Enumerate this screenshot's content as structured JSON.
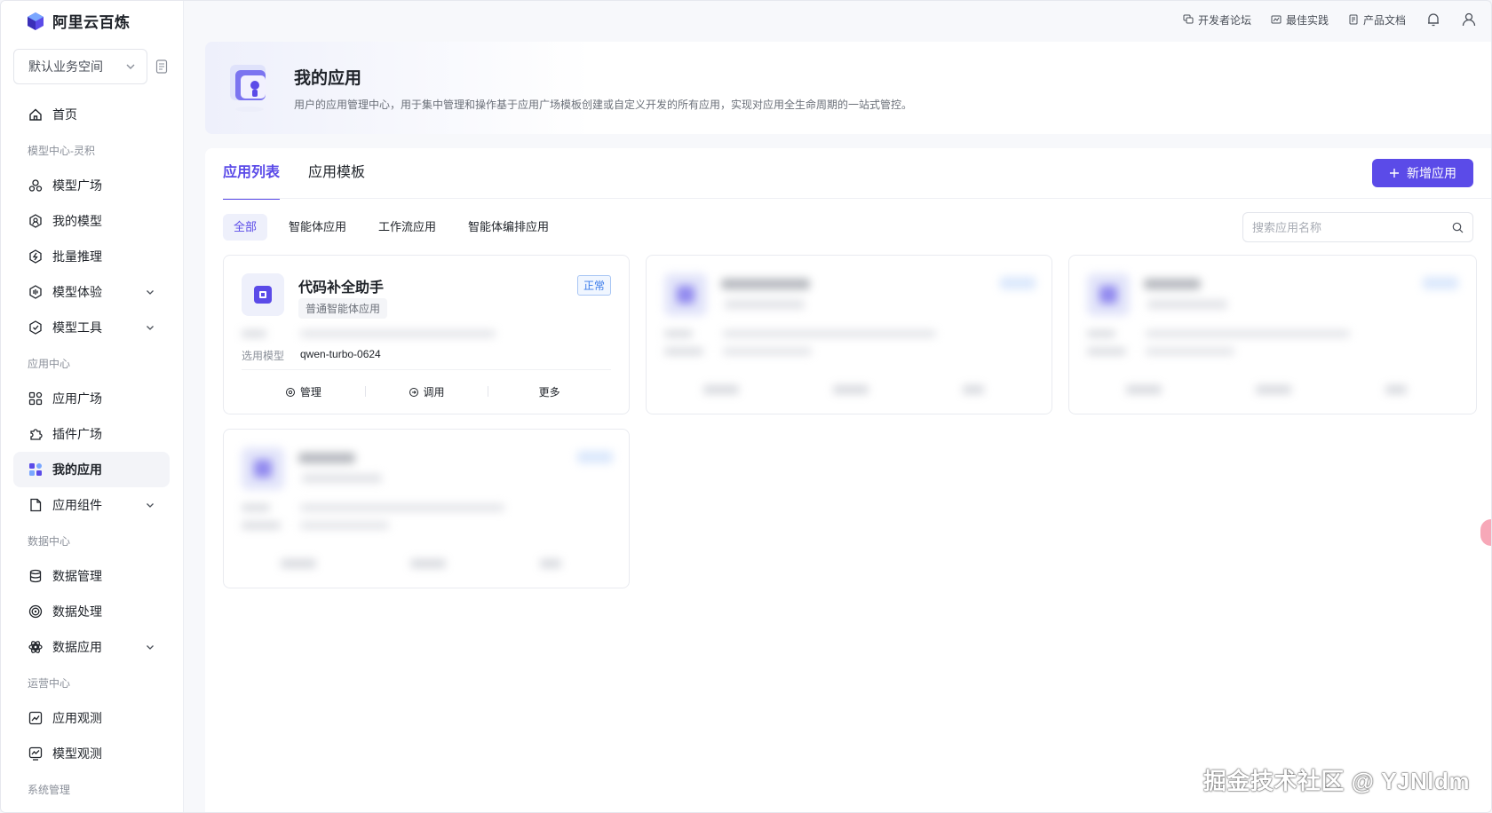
{
  "app": {
    "logo_text": "阿里云百炼",
    "accent": "#5b4be8"
  },
  "sidebar": {
    "workspace": "默认业务空间",
    "items": [
      {
        "type": "item",
        "label": "首页",
        "icon": "home-icon"
      },
      {
        "type": "group",
        "label": "模型中心-灵积"
      },
      {
        "type": "item",
        "label": "模型广场",
        "icon": "model-square-icon"
      },
      {
        "type": "item",
        "label": "我的模型",
        "icon": "my-model-icon"
      },
      {
        "type": "item",
        "label": "批量推理",
        "icon": "batch-inference-icon"
      },
      {
        "type": "item",
        "label": "模型体验",
        "icon": "model-trial-icon",
        "expandable": true
      },
      {
        "type": "item",
        "label": "模型工具",
        "icon": "model-tools-icon",
        "expandable": true
      },
      {
        "type": "group",
        "label": "应用中心"
      },
      {
        "type": "item",
        "label": "应用广场",
        "icon": "app-square-icon"
      },
      {
        "type": "item",
        "label": "插件广场",
        "icon": "plugin-icon"
      },
      {
        "type": "item",
        "label": "我的应用",
        "icon": "my-apps-icon",
        "active": true
      },
      {
        "type": "item",
        "label": "应用组件",
        "icon": "app-components-icon",
        "expandable": true
      },
      {
        "type": "group",
        "label": "数据中心"
      },
      {
        "type": "item",
        "label": "数据管理",
        "icon": "database-icon"
      },
      {
        "type": "item",
        "label": "数据处理",
        "icon": "data-processing-icon"
      },
      {
        "type": "item",
        "label": "数据应用",
        "icon": "data-app-icon",
        "expandable": true
      },
      {
        "type": "group",
        "label": "运营中心"
      },
      {
        "type": "item",
        "label": "应用观测",
        "icon": "app-monitor-icon"
      },
      {
        "type": "item",
        "label": "模型观测",
        "icon": "model-monitor-icon"
      },
      {
        "type": "group",
        "label": "系统管理"
      }
    ]
  },
  "topbar": {
    "links": [
      "开发者论坛",
      "最佳实践",
      "产品文档"
    ]
  },
  "header": {
    "title": "我的应用",
    "description": "用户的应用管理中心，用于集中管理和操作基于应用广场模板创建或自定义开发的所有应用，实现对应用全生命周期的一站式管控。"
  },
  "main": {
    "tabs": [
      {
        "label": "应用列表",
        "active": true
      },
      {
        "label": "应用模板"
      }
    ],
    "add_button": "新增应用",
    "filters": [
      {
        "label": "全部",
        "active": true
      },
      {
        "label": "智能体应用"
      },
      {
        "label": "工作流应用"
      },
      {
        "label": "智能体编排应用"
      }
    ],
    "search_placeholder": "搜索应用名称",
    "cards": [
      {
        "title": "代码补全助手",
        "type": "普通智能体应用",
        "status": "正常",
        "model_label": "选用模型",
        "model": "qwen-turbo-0624",
        "actions": [
          "管理",
          "调用",
          "更多"
        ]
      }
    ]
  },
  "watermark": "掘金技术社区 @ YJNldm"
}
